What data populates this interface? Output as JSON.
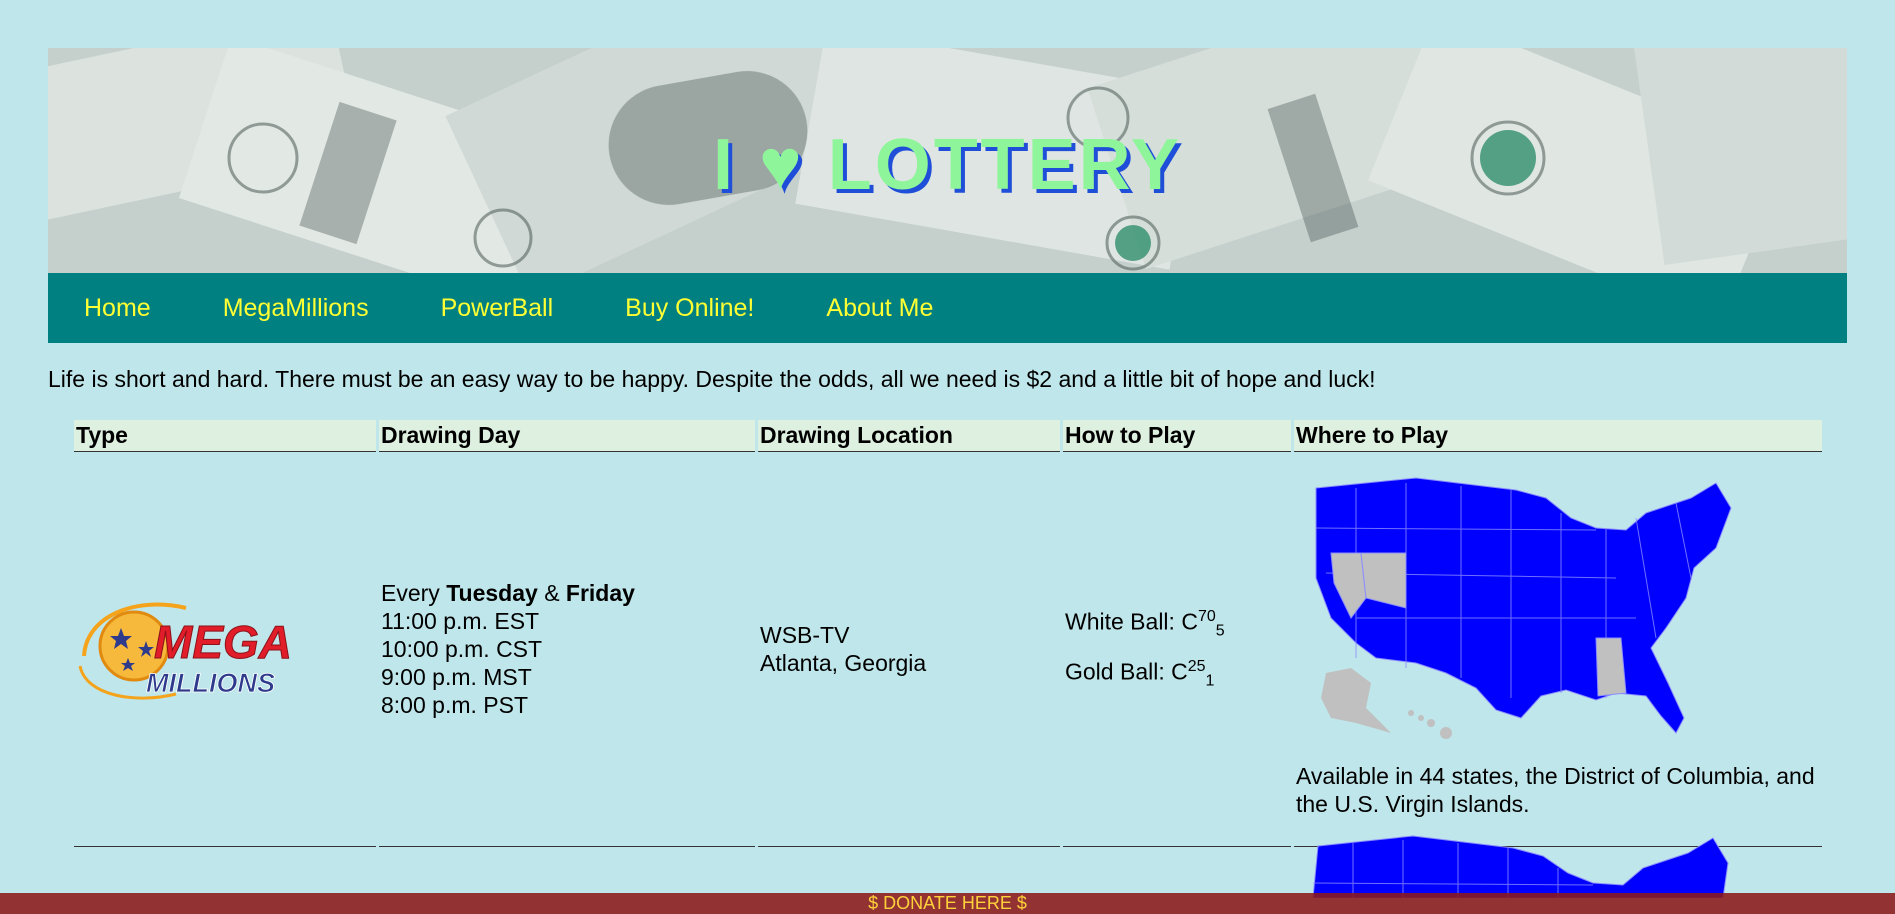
{
  "banner": {
    "title": "I ♥ LOTTERY"
  },
  "nav": {
    "items": [
      "Home",
      "MegaMillions",
      "PowerBall",
      "Buy Online!",
      "About Me"
    ]
  },
  "intro_text": "Life is short and hard. There must be an easy way to be happy. Despite the odds, all we need is $2 and a little bit of hope and luck!",
  "table": {
    "headers": [
      "Type",
      "Drawing Day",
      "Drawing Location",
      "How to Play",
      "Where to Play"
    ],
    "rows": [
      {
        "logo_top": "MEGA",
        "logo_bottom": "MILLIONS",
        "drawing_every": "Every",
        "day1": "Tuesday",
        "amp": "&",
        "day2": "Friday",
        "times": [
          "11:00 p.m. EST",
          "10:00 p.m. CST",
          "9:00 p.m. MST",
          "8:00 p.m. PST"
        ],
        "location_line1": "WSB-TV",
        "location_line2": "Atlanta, Georgia",
        "white_ball_label": "White Ball: C",
        "white_ball_sup": "70",
        "white_ball_sub": "5",
        "gold_ball_label": "Gold Ball: C",
        "gold_ball_sup": "25",
        "gold_ball_sub": "1",
        "availability": "Available in 44 states, the District of Columbia, and the U.S. Virgin Islands."
      }
    ]
  },
  "donate": {
    "label": "$ DONATE HERE $"
  },
  "colors": {
    "page_bg": "#bfe6ea",
    "nav_bg": "#008080",
    "nav_text": "#ffff33",
    "header_row_bg": "#def0df",
    "map_states": "#0000ff",
    "map_excluded": "#c0c0c0",
    "donate_bg": "#8c1919",
    "donate_text": "#ffd23a"
  }
}
